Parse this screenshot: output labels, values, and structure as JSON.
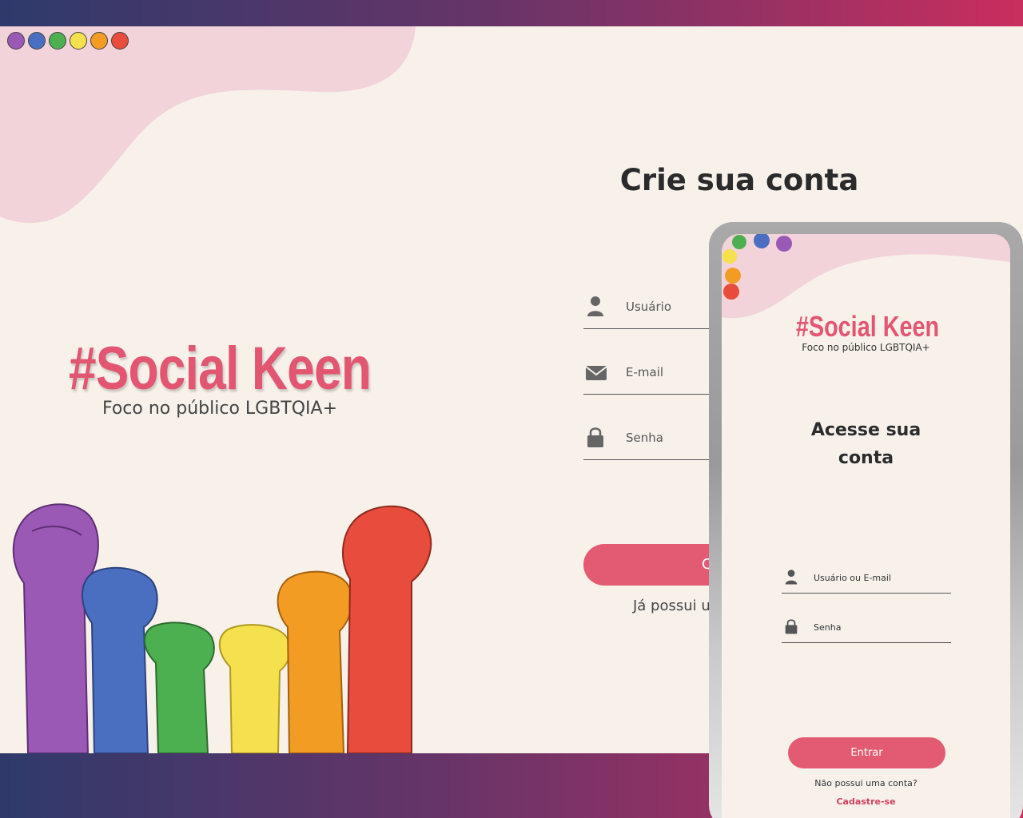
{
  "window": {
    "dots": [
      {
        "name": "purple",
        "color": "#9b59b6"
      },
      {
        "name": "blue",
        "color": "#4a6fc0"
      },
      {
        "name": "green",
        "color": "#4caf50"
      },
      {
        "name": "yellow",
        "color": "#f5e04d"
      },
      {
        "name": "orange",
        "color": "#f39c24"
      },
      {
        "name": "red",
        "color": "#e74c3c"
      }
    ]
  },
  "brand": {
    "title": "#Social Keen",
    "subtitle": "Foco no público LGBTQIA+",
    "color": "#e35672"
  },
  "signup": {
    "title": "Crie sua conta",
    "fields": [
      {
        "label": "Usuário",
        "icon": "user-icon"
      },
      {
        "label": "E-mail",
        "icon": "envelope-icon"
      },
      {
        "label": "Senha",
        "icon": "lock-icon"
      }
    ],
    "button_partial": "Ca",
    "already_partial": "Já possui ur"
  },
  "mobile": {
    "brand_title": "#Social Keen",
    "brand_subtitle": "Foco no público LGBTQIA+",
    "title_line1": "Acesse sua",
    "title_line2": "conta",
    "fields": [
      {
        "label": "Usuário ou E-mail",
        "icon": "user-icon"
      },
      {
        "label": "Senha",
        "icon": "lock-icon"
      }
    ],
    "login_button": "Entrar",
    "no_account": "Não possui uma conta?",
    "signup_link": "Cadastre-se"
  },
  "colors": {
    "accent": "#e35b73",
    "background": "#f7f1ea",
    "blob": "#f2d3da",
    "gradient_start": "#2e3a6b",
    "gradient_end": "#c92e5e"
  }
}
